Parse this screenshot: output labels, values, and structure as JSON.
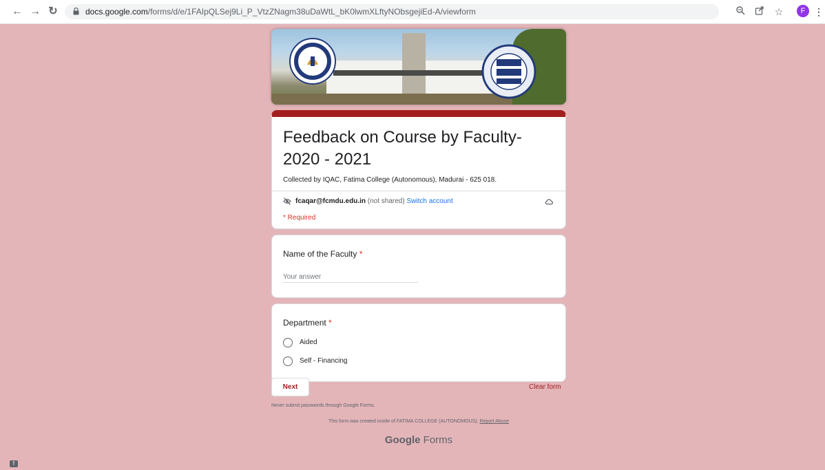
{
  "browser": {
    "url_host": "docs.google.com",
    "url_path": "/forms/d/e/1FAIpQLSej9Li_P_VtzZNagm38uDaWtL_bK0lwmXLftyNObsgejiEd-A/viewform",
    "avatar_letter": "F"
  },
  "banner": {
    "left_seal_text_top": "FATIMA COLLEGE",
    "left_seal_text_bottom": "MADURAI",
    "right_seal_lines": [
      "QUALITY",
      "EVALUATION",
      "SUSTENANCE"
    ]
  },
  "form": {
    "title": "Feedback on Course by Faculty-2020 - 2021",
    "description": "Collected by IQAC, Fatima College (Autonomous), Madurai - 625 018.",
    "account_email": "fcaqar@fcmdu.edu.in",
    "not_shared": "(not shared)",
    "switch_account": "Switch account",
    "required_note": "* Required"
  },
  "questions": {
    "faculty_label": "Name of the Faculty",
    "faculty_placeholder": "Your answer",
    "department_label": "Department",
    "required_star": "*",
    "department_options": [
      "Aided",
      "Self - Financing"
    ]
  },
  "footer": {
    "next_label": "Next",
    "clear_label": "Clear form",
    "never_submit": "Never submit passwords through Google Forms.",
    "created_text": "This form was created inside of FATIMA COLLEGE (AUTONOMOUS).",
    "report_abuse": "Report Abuse",
    "google_brand": "Google",
    "forms_brand": "Forms"
  },
  "colors": {
    "page_bg": "#e3b5b9",
    "accent": "#a31f1f",
    "link": "#1a73e8",
    "required": "#d93025"
  }
}
